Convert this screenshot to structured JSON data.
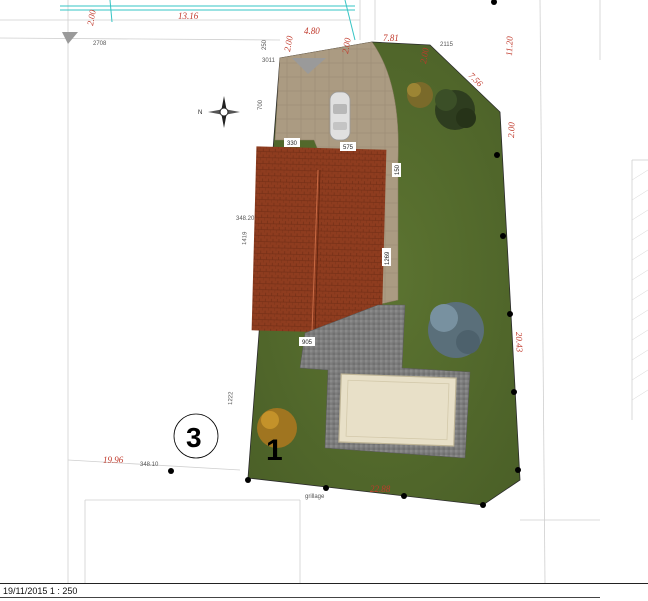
{
  "footer": {
    "text": "19/11/2015 1 : 250"
  },
  "plan": {
    "dimensions": {
      "d_2_00_top_left": "2.00",
      "d_13_16": "13.16",
      "d_4_80": "4.80",
      "d_2_00_gate_a": "2.00",
      "d_2_00_gate_b": "2.00",
      "d_7_81": "7.81",
      "d_2_00_upper": "2.00",
      "d_7_56": "7.56",
      "d_11_20": "11.20",
      "d_2_00_right": "2.00",
      "d_20_43": "20.43",
      "d_19_96": "19.96",
      "d_22_88": "22.88"
    },
    "labels": {
      "l_250": "250",
      "l_700": "700",
      "l_1419": "1419",
      "l_1222": "1222",
      "l_330": "330",
      "l_575": "575",
      "l_150": "150",
      "l_1269": "1269",
      "l_905": "905",
      "l_2708": "2708",
      "l_3011": "3011",
      "l_2115": "2115",
      "l_348_20": "348.20",
      "l_348_10": "348.10",
      "l_grillage": "grillage",
      "l_compass_n": "N"
    },
    "lot_number": "3",
    "parcel_number": "1"
  },
  "colors": {
    "lawn": "#556b2f",
    "roof": "#8b3a1e",
    "terrace": "#a89880",
    "paving": "#7a7a7a",
    "pool": "#e8e0c8",
    "dimension_text": "#c0392b",
    "boundary": "#000000"
  }
}
